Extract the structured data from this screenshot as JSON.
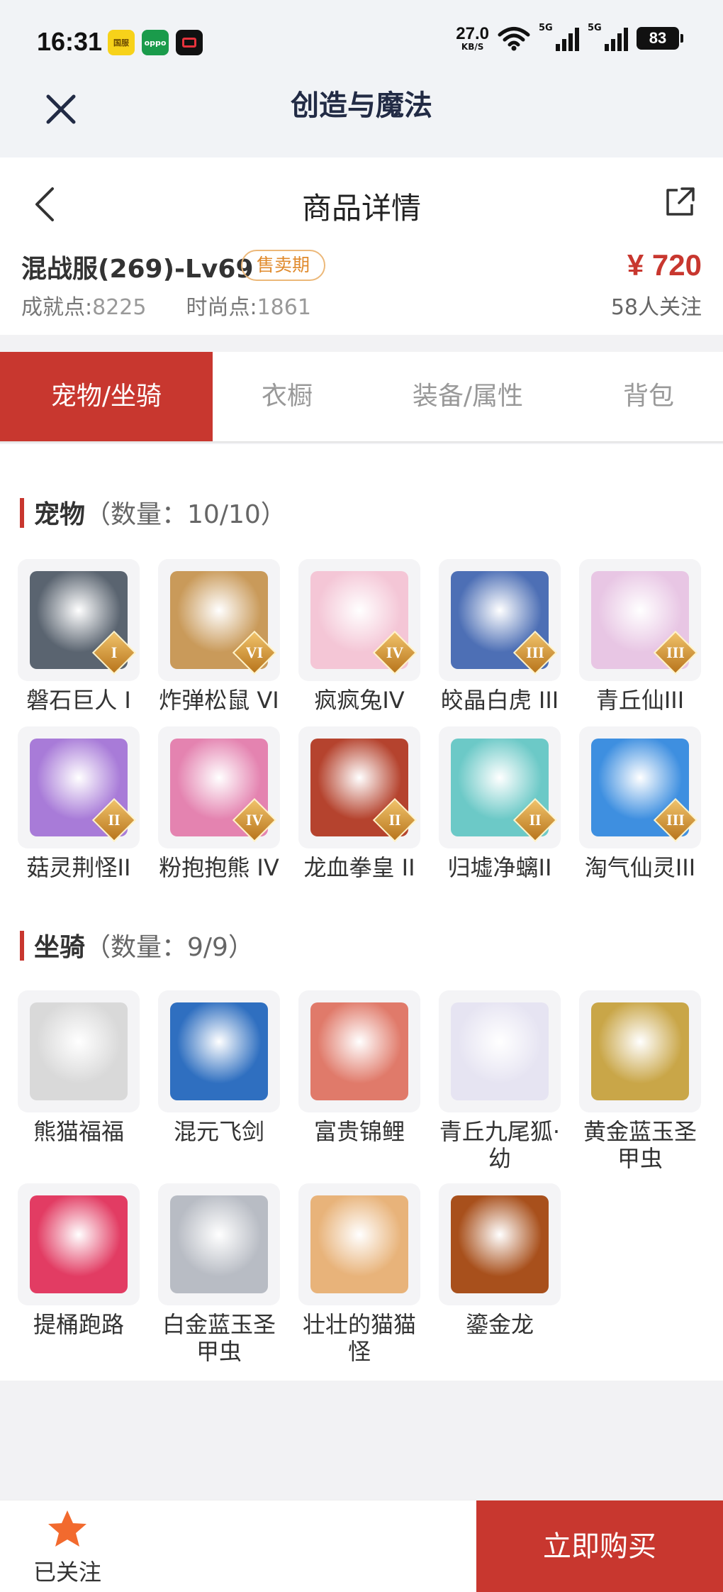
{
  "status_bar": {
    "time": "16:31",
    "app_icons": [
      {
        "name": "mini-game-app-icon",
        "label": "国服"
      },
      {
        "name": "oppo-app-icon",
        "label": "oppo"
      },
      {
        "name": "video-recorder-icon",
        "label": ""
      }
    ],
    "net_speed": "27.0",
    "net_speed_unit": "KB/S",
    "signal_label_1": "5G",
    "signal_label_2": "5G",
    "battery": "83"
  },
  "app_header": {
    "title": "创造与魔法",
    "close_icon": "close-icon"
  },
  "product": {
    "page_title": "商品详情",
    "name": "混战服(269)-Lv69",
    "badge": "售卖期",
    "price": "¥ 720",
    "achievement_label": "成就点:",
    "achievement_value": "8225",
    "fashion_label": "时尚点:",
    "fashion_value": "1861",
    "followers": "58人关注"
  },
  "tabs": [
    {
      "label": "宠物/坐骑",
      "active": true
    },
    {
      "label": "衣橱",
      "active": false
    },
    {
      "label": "装备/属性",
      "active": false
    },
    {
      "label": "背包",
      "active": false
    }
  ],
  "pets": {
    "title": "宠物",
    "count": "（数量：10/10）",
    "items": [
      {
        "name": "磐石巨人 I",
        "tier": "I",
        "color": "#5a6470"
      },
      {
        "name": "炸弹松鼠 VI",
        "tier": "VI",
        "color": "#c99a5a"
      },
      {
        "name": "疯疯兔IV",
        "tier": "IV",
        "color": "#f4c6d6"
      },
      {
        "name": "皎晶白虎 III",
        "tier": "III",
        "color": "#4d6fb5"
      },
      {
        "name": "青丘仙III",
        "tier": "III",
        "color": "#e8c6e4"
      },
      {
        "name": "菇灵荆怪II",
        "tier": "II",
        "color": "#a87bd8"
      },
      {
        "name": "粉抱抱熊 IV",
        "tier": "IV",
        "color": "#e483b0"
      },
      {
        "name": "龙血拳皇 II",
        "tier": "II",
        "color": "#b5432e"
      },
      {
        "name": "归墟净螭II",
        "tier": "II",
        "color": "#6cc9c7"
      },
      {
        "name": "淘气仙灵III",
        "tier": "III",
        "color": "#3e8fe0"
      }
    ]
  },
  "mounts": {
    "title": "坐骑",
    "count": "（数量：9/9）",
    "items": [
      {
        "name": "熊猫福福",
        "color": "#d9d9d9"
      },
      {
        "name": "混元飞剑",
        "color": "#2f6fc0"
      },
      {
        "name": "富贵锦鲤",
        "color": "#e07a6a"
      },
      {
        "name": "青丘九尾狐·幼",
        "color": "#e6e4f2"
      },
      {
        "name": "黄金蓝玉圣甲虫",
        "color": "#c9a648"
      },
      {
        "name": "提桶跑路",
        "color": "#e23c63"
      },
      {
        "name": "白金蓝玉圣甲虫",
        "color": "#b8bcc4"
      },
      {
        "name": "壮壮的猫猫怪",
        "color": "#e8b37a"
      },
      {
        "name": "鎏金龙",
        "color": "#a8501c"
      }
    ]
  },
  "bottom_bar": {
    "follow_label": "已关注",
    "buy_label": "立即购买"
  }
}
